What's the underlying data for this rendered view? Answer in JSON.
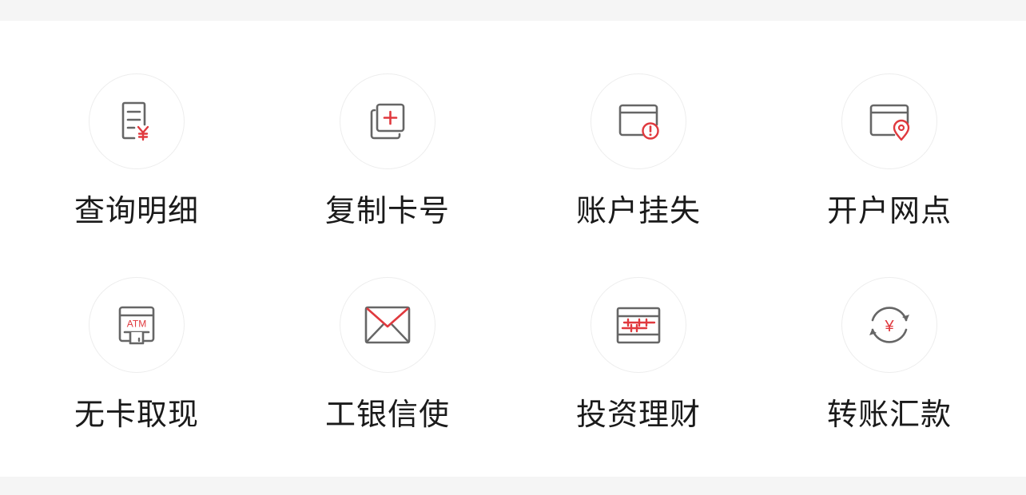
{
  "colors": {
    "accent": "#e0393e",
    "icon_gray": "#666666",
    "label": "#1a1a1a",
    "page_bg": "#f5f5f5",
    "panel_bg": "#ffffff"
  },
  "menu": {
    "items": [
      {
        "label": "查询明细",
        "icon": "statement-icon"
      },
      {
        "label": "复制卡号",
        "icon": "copy-card-icon"
      },
      {
        "label": "账户挂失",
        "icon": "card-alert-icon"
      },
      {
        "label": "开户网点",
        "icon": "card-location-icon"
      },
      {
        "label": "无卡取现",
        "icon": "atm-icon",
        "icon_text": "ATM"
      },
      {
        "label": "工银信使",
        "icon": "envelope-icon"
      },
      {
        "label": "投资理财",
        "icon": "investment-icon"
      },
      {
        "label": "转账汇款",
        "icon": "transfer-icon",
        "icon_text": "¥"
      }
    ]
  }
}
